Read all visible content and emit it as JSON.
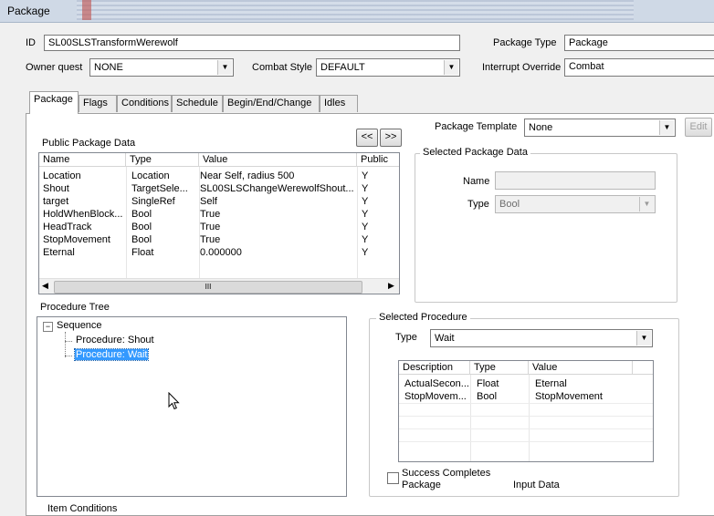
{
  "window": {
    "title": "Package"
  },
  "form": {
    "id_label": "ID",
    "id_value": "SL00SLSTransformWerewolf",
    "package_type_label": "Package Type",
    "package_type_value": "Package",
    "owner_quest_label": "Owner quest",
    "owner_quest_value": "NONE",
    "combat_style_label": "Combat Style",
    "combat_style_value": "DEFAULT",
    "interrupt_override_label": "Interrupt Override",
    "interrupt_override_value": "Combat"
  },
  "tabs": [
    {
      "label": "Package",
      "active": true
    },
    {
      "label": "Flags"
    },
    {
      "label": "Conditions"
    },
    {
      "label": "Schedule"
    },
    {
      "label": "Begin/End/Change"
    },
    {
      "label": "Idles"
    }
  ],
  "public_data": {
    "title": "Public Package Data",
    "prev_label": "<<",
    "next_label": ">>",
    "columns": [
      "Name",
      "Type",
      "Value",
      "Public"
    ],
    "rows": [
      [
        "Location",
        "Location",
        "Near Self, radius 500",
        "Y"
      ],
      [
        "Shout",
        "TargetSele...",
        "SL00SLSChangeWerewolfShout...",
        "Y"
      ],
      [
        "target",
        "SingleRef",
        "Self",
        "Y"
      ],
      [
        "HoldWhenBlock...",
        "Bool",
        "True",
        "Y"
      ],
      [
        "HeadTrack",
        "Bool",
        "True",
        "Y"
      ],
      [
        "StopMovement",
        "Bool",
        "True",
        "Y"
      ],
      [
        "Eternal",
        "Float",
        "0.000000",
        "Y"
      ]
    ],
    "scroll_grip": "III"
  },
  "template": {
    "label": "Package Template",
    "value": "None",
    "edit_label": "Edit"
  },
  "selected_package_data": {
    "title": "Selected Package Data",
    "name_label": "Name",
    "name_value": "",
    "type_label": "Type",
    "type_value": "Bool"
  },
  "procedure_tree": {
    "title": "Procedure Tree",
    "root": "Sequence",
    "toggle": "−",
    "children": [
      "Procedure: Shout",
      "Procedure: Wait"
    ],
    "selected_index": 1
  },
  "selected_procedure": {
    "title": "Selected Procedure",
    "type_label": "Type",
    "type_value": "Wait",
    "columns": [
      "Description",
      "Type",
      "Value"
    ],
    "rows": [
      [
        "ActualSecon...",
        "Float",
        "Eternal"
      ],
      [
        "StopMovem...",
        "Bool",
        "StopMovement"
      ]
    ],
    "success_line1": "Success Completes",
    "success_line2": "Package",
    "input_data_label": "Input Data",
    "success_checked": false
  },
  "cutoff_label": "Item Conditions",
  "colors": {
    "selection": "#3399ff",
    "window_bg": "#f0f0f0",
    "titlebar": "#cfd9e6"
  }
}
